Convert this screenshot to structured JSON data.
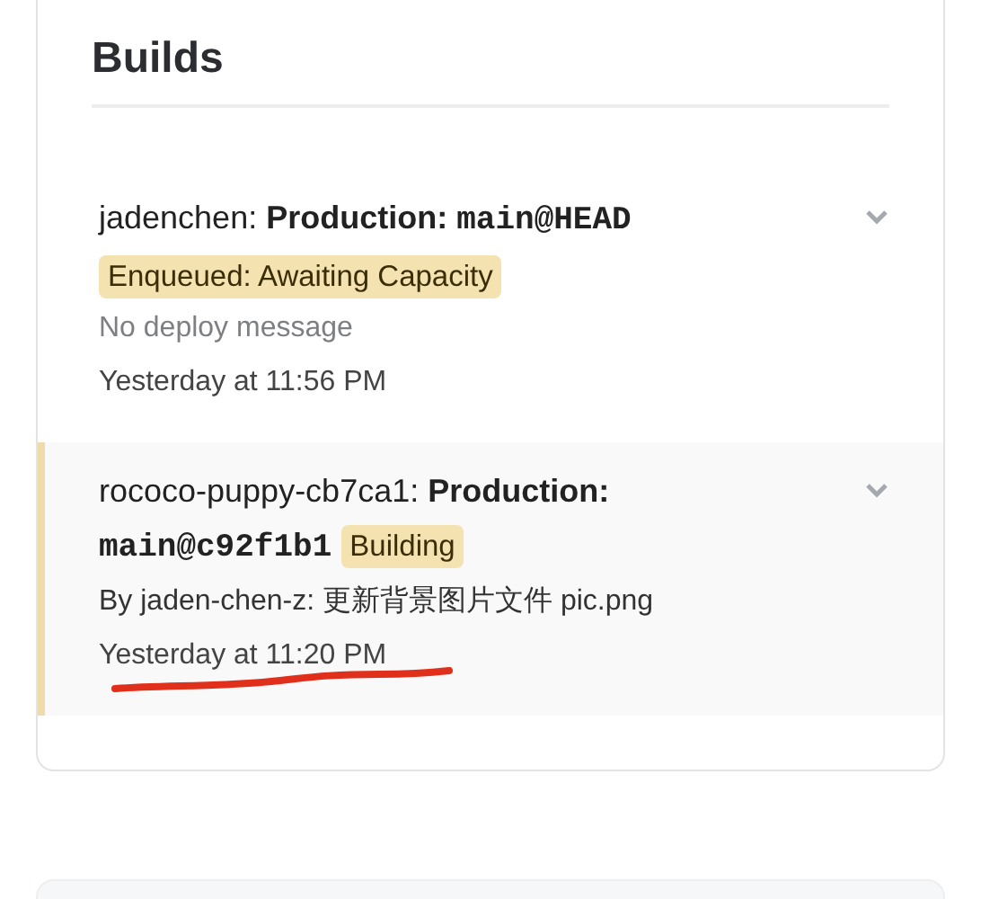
{
  "section": {
    "title": "Builds"
  },
  "builds": [
    {
      "author": "jadenchen:",
      "environment": "Production:",
      "ref": "main@HEAD",
      "status": "Enqueued: Awaiting Capacity",
      "message": "No deploy message",
      "message_muted": true,
      "time": "Yesterday at 11:56 PM",
      "selected": false,
      "annotated": false
    },
    {
      "author": "rococo-puppy-cb7ca1:",
      "environment": "Production:",
      "ref": "main@c92f1b1",
      "status": "Building",
      "message": "By jaden-chen-z: 更新背景图片文件 pic.png",
      "message_muted": false,
      "time": "Yesterday at 11:20 PM",
      "selected": true,
      "annotated": true
    }
  ]
}
